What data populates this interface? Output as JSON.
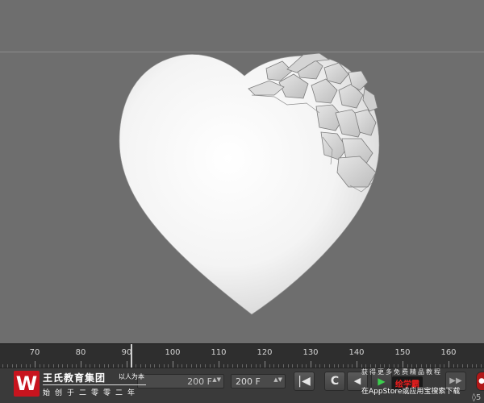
{
  "timeline": {
    "ticks": [
      "70",
      "80",
      "90",
      "100",
      "110",
      "120",
      "130",
      "140",
      "150",
      "160"
    ],
    "current_frame_value": 91
  },
  "transport": {
    "frame_field_value": "200 F",
    "end_field_value": "200 F",
    "spin_glyph": "▲▼",
    "buttons": {
      "first_frame": "|◀",
      "loop": "C",
      "prev_frame": "◀",
      "play": "▶",
      "next_frame": "▶▶",
      "record": "●"
    }
  },
  "watermark": {
    "logo_glyph": "W",
    "brand_name": "王氏教育集团",
    "motto": "以人为本",
    "subtitle": "始创于二零零二年",
    "promo_top": "获得更多免费精品教程",
    "promo_app": "绘学霸",
    "promo_bottom": "在AppStore或应用宝搜索下载",
    "corner_glyph": "◊5"
  },
  "colors": {
    "viewport_bg": "#6e6e6e",
    "horizon": "#8c8c8c",
    "heart": "#f2f2f2",
    "timeline_bg": "#2e2e2e",
    "transport_bg": "#3a3a3a",
    "logo_red": "#c8141e",
    "play_green": "#3ccf4e"
  },
  "icons": [
    "heart-model",
    "first-frame-icon",
    "loop-icon",
    "prev-frame-icon",
    "play-icon",
    "next-frame-icon",
    "record-icon",
    "logo-icon"
  ]
}
